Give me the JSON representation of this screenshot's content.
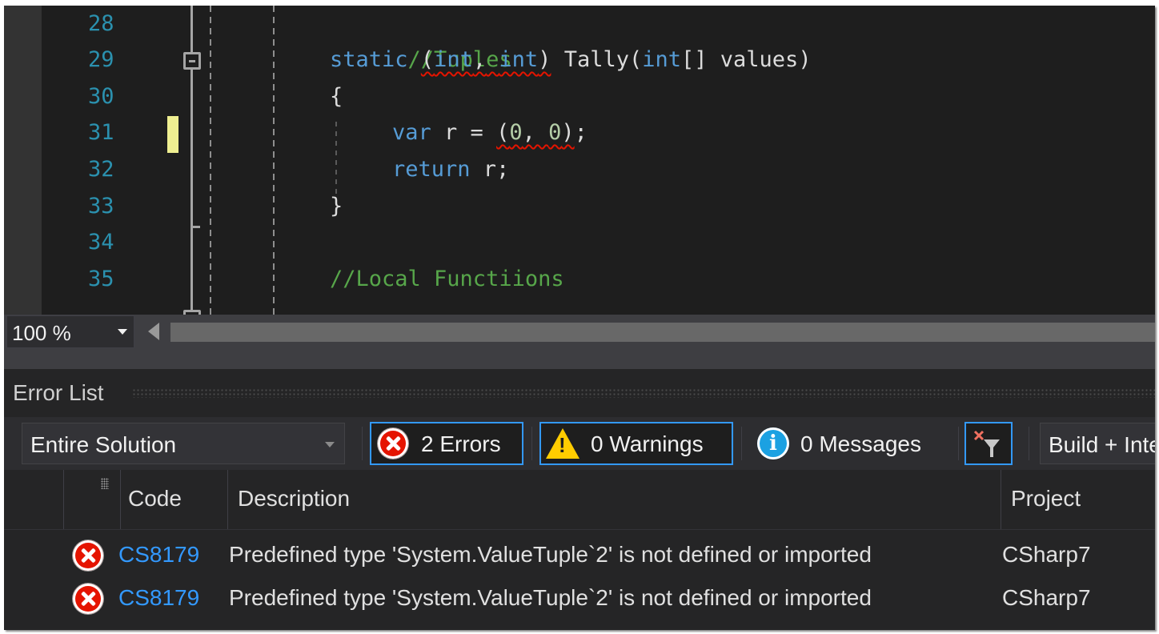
{
  "editor": {
    "line_numbers": [
      "28",
      "29",
      "30",
      "31",
      "32",
      "33",
      "34",
      "35"
    ],
    "lines": {
      "l28": {
        "comment": "//Tuples"
      },
      "l29": {
        "kw_static": "static",
        "paren_open": "(",
        "kw_int1": "int",
        "comma": ",",
        "kw_int2": "int",
        "paren_close": ")",
        "method": " Tally(",
        "kw_int3": "int",
        "rest": "[] values)"
      },
      "l30": {
        "text": "{"
      },
      "l31": {
        "kw_var": "var",
        "mid": " r = ",
        "p_open": "(",
        "n1": "0",
        "sep": ", ",
        "n2": "0",
        "p_close": ")",
        "end": ";"
      },
      "l32": {
        "kw_return": "return",
        "rest": " r;"
      },
      "l33": {
        "text": "}"
      },
      "l35": {
        "comment": "//Local Functiions"
      }
    },
    "colors": {
      "keyword": "#569cd6",
      "comment": "#57a64a",
      "line_number": "#2b91af",
      "number": "#b5cea8",
      "squiggle": "#e51400",
      "change_marker": "#efef91"
    }
  },
  "zoom": {
    "value": "100 %"
  },
  "error_list": {
    "title": "Error List",
    "scope": "Entire Solution",
    "errors_button": "2 Errors",
    "warnings_button": "0 Warnings",
    "messages_button": "0 Messages",
    "build_select": "Build + IntelliSense",
    "columns": {
      "code": "Code",
      "description": "Description",
      "project": "Project"
    },
    "rows": [
      {
        "code": "CS8179",
        "description": "Predefined type 'System.ValueTuple`2' is not defined or imported",
        "project": "CSharp7"
      },
      {
        "code": "CS8179",
        "description": "Predefined type 'System.ValueTuple`2' is not defined or imported",
        "project": "CSharp7"
      }
    ],
    "colors": {
      "accent": "#3399ff",
      "error": "#e51400",
      "warning": "#ffcc00",
      "info": "#1ba1e2"
    }
  }
}
